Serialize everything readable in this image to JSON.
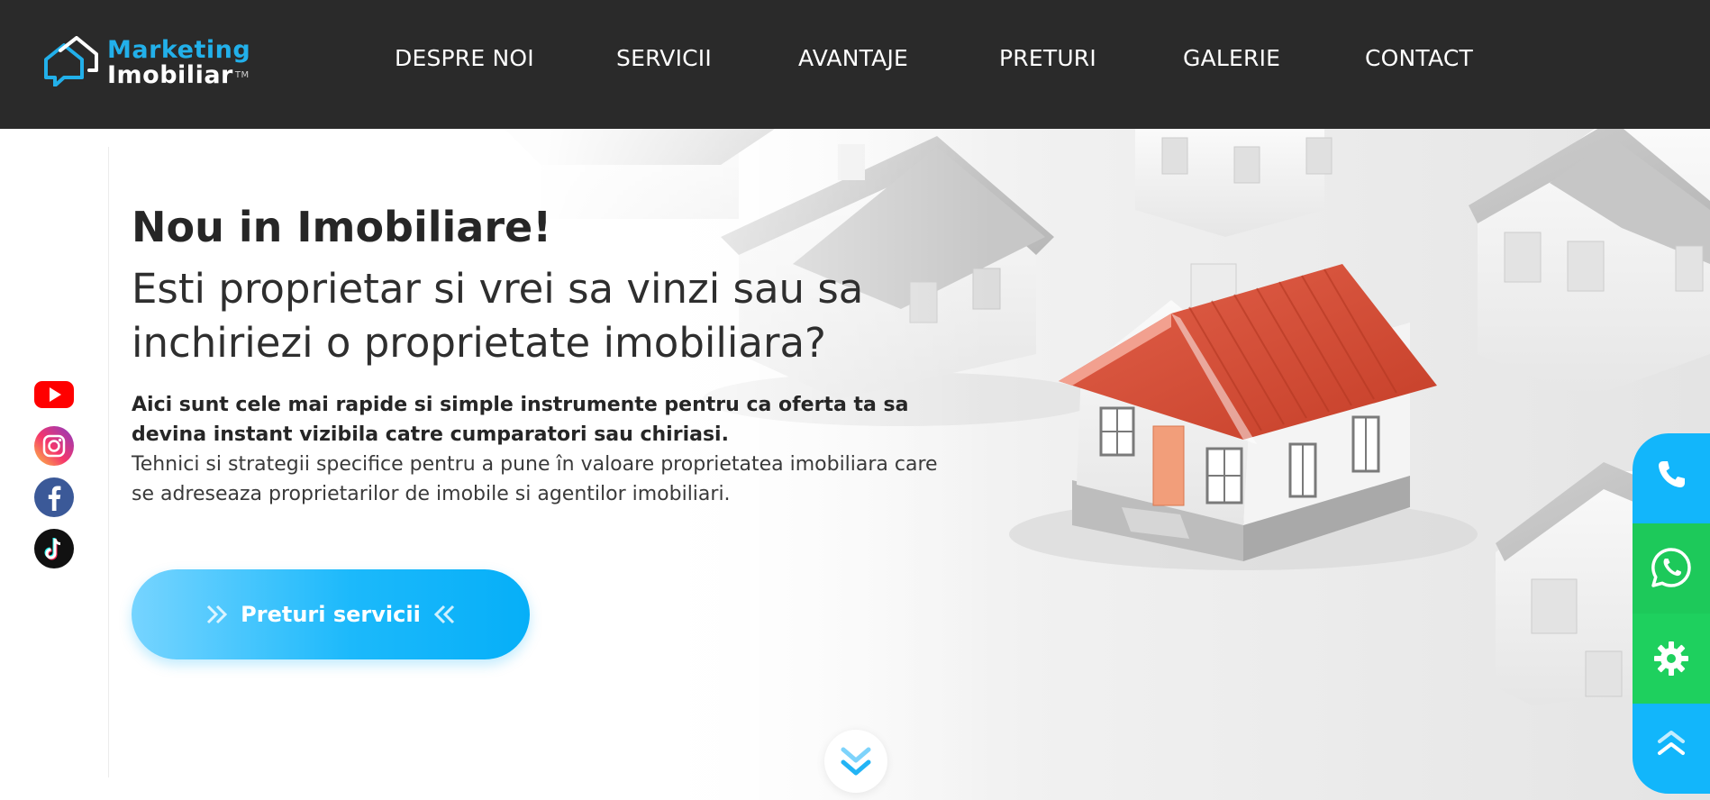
{
  "brand": {
    "line1": "Marketing",
    "line2": "Imobiliar",
    "tm": "TM"
  },
  "nav": {
    "items": [
      {
        "label": "DESPRE NOI"
      },
      {
        "label": "SERVICII"
      },
      {
        "label": "AVANTAJE"
      },
      {
        "label": "PRETURI"
      },
      {
        "label": "GALERIE"
      },
      {
        "label": "CONTACT"
      }
    ]
  },
  "hero": {
    "title_bold": "Nou in Imobiliare!",
    "title_light": "Esti proprietar si vrei sa vinzi sau sa inchiriezi o proprietate imobiliara?",
    "desc_bold": "Aici sunt cele mai rapide si simple instrumente pentru ca oferta ta sa devina instant vizibila catre cumparatori sau chiriasi.",
    "desc_normal": "Tehnici si strategii specifice pentru a pune în valoare proprietatea imobiliara care se adreseaza proprietarilor de imobile si agentilor imobiliari.",
    "cta_label": "Preturi servicii"
  },
  "social": {
    "items": [
      "youtube-icon",
      "instagram-icon",
      "facebook-icon",
      "tiktok-icon"
    ]
  },
  "floating_bar": {
    "items": [
      "phone-icon",
      "whatsapp-icon",
      "gear-icon",
      "chevron-up-icon"
    ]
  },
  "colors": {
    "header_bg": "#2a2a2a",
    "accent": "#06aff8",
    "brand_blue": "#22b0ea",
    "whatsapp_green": "#1dc95a",
    "roof_red": "#d9513a"
  }
}
